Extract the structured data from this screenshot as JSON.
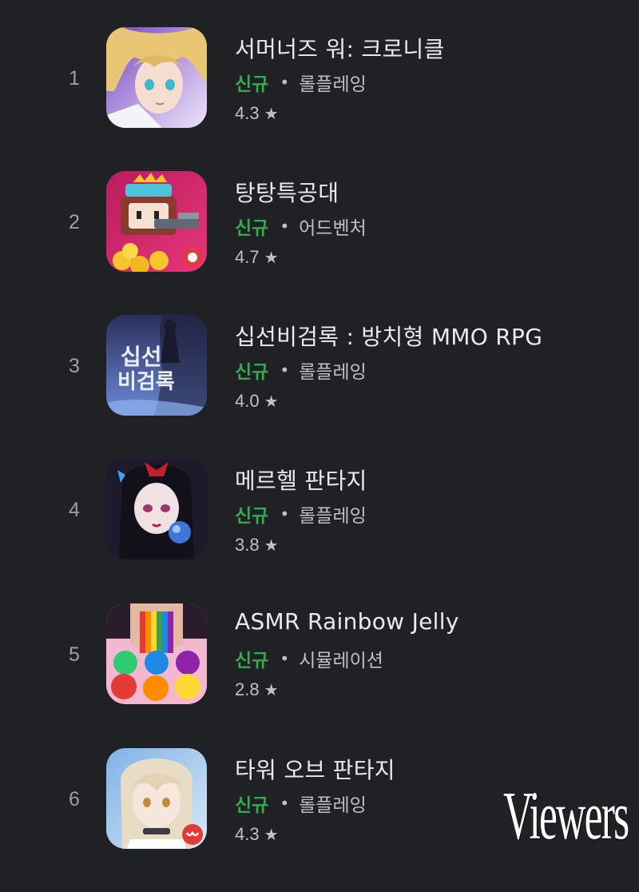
{
  "apps": [
    {
      "rank": "1",
      "title": "서머너즈 워: 크로니클",
      "badge": "신규",
      "category": "롤플레잉",
      "rating": "4.3",
      "icon": "summoners-war-chronicles-icon"
    },
    {
      "rank": "2",
      "title": "탕탕특공대",
      "badge": "신규",
      "category": "어드벤처",
      "rating": "4.7",
      "icon": "tangtang-special-forces-icon"
    },
    {
      "rank": "3",
      "title": "십선비검록 : 방치형 MMO RPG",
      "badge": "신규",
      "category": "롤플레잉",
      "rating": "4.0",
      "icon": "sipseon-bigeomrok-icon",
      "icon_text": [
        "십선",
        "비검록"
      ]
    },
    {
      "rank": "4",
      "title": "메르헬 판타지",
      "badge": "신규",
      "category": "롤플레잉",
      "rating": "3.8",
      "icon": "merhel-fantasy-icon"
    },
    {
      "rank": "5",
      "title": "ASMR Rainbow Jelly",
      "badge": "신규",
      "category": "시뮬레이션",
      "rating": "2.8",
      "icon": "asmr-rainbow-jelly-icon"
    },
    {
      "rank": "6",
      "title": "타워 오브 판타지",
      "badge": "신규",
      "category": "롤플레잉",
      "rating": "4.3",
      "icon": "tower-of-fantasy-icon"
    }
  ],
  "separator": "•",
  "star": "★",
  "watermark": "Viewers",
  "colors": {
    "background": "#202124",
    "title": "#e8eaed",
    "badge_new": "#34a853",
    "secondary_text": "#bdc1c6"
  }
}
